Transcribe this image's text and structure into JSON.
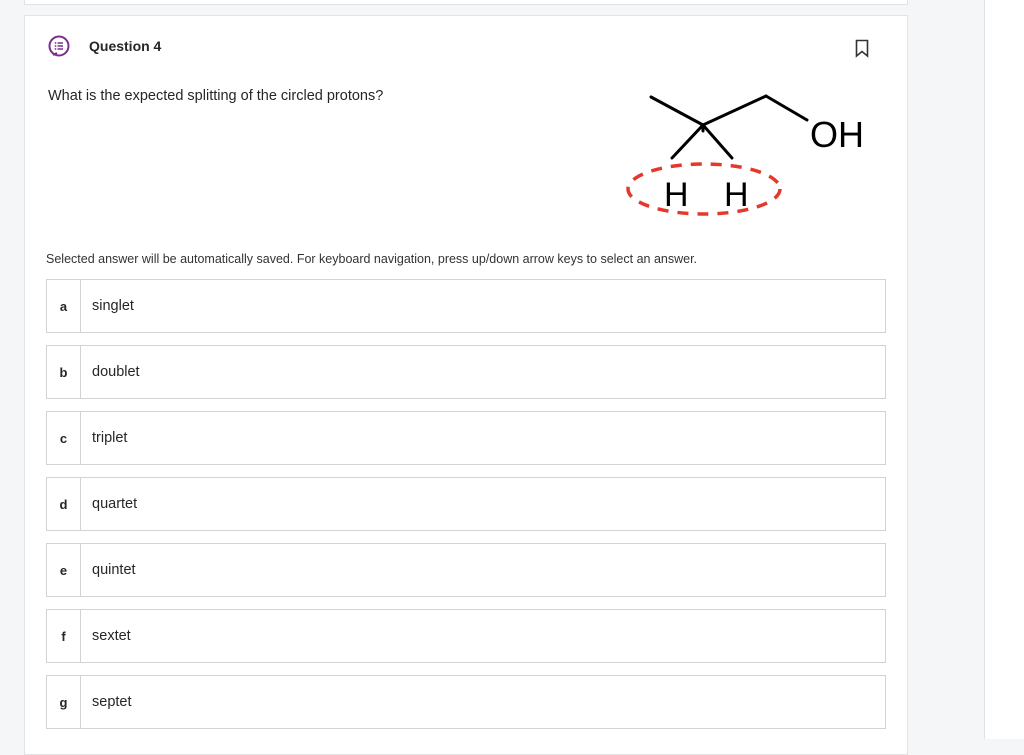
{
  "question": {
    "title": "Question 4",
    "prompt": "What is the expected splitting of the circled protons?",
    "instructions": "Selected answer will be automatically saved. For keyboard navigation, press up/down arrow keys to select an answer.",
    "bookmark_icon": "bookmark-icon",
    "type_icon": "multiple-choice-icon",
    "accent_color": "#7b2d8e",
    "figure": {
      "group_label": "OH",
      "proton_labels": [
        "H",
        "H"
      ],
      "circle_color": "#e5372b"
    }
  },
  "options": [
    {
      "letter": "a",
      "text": "singlet"
    },
    {
      "letter": "b",
      "text": "doublet"
    },
    {
      "letter": "c",
      "text": "triplet"
    },
    {
      "letter": "d",
      "text": "quartet"
    },
    {
      "letter": "e",
      "text": "quintet"
    },
    {
      "letter": "f",
      "text": "sextet"
    },
    {
      "letter": "g",
      "text": "septet"
    }
  ]
}
